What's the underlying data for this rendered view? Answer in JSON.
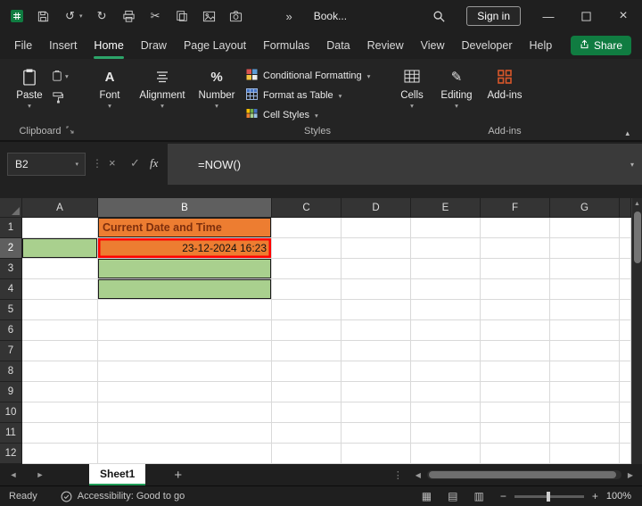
{
  "titlebar": {
    "title": "Book...",
    "sign_in_label": "Sign in"
  },
  "menubar": {
    "items": [
      "File",
      "Insert",
      "Home",
      "Draw",
      "Page Layout",
      "Formulas",
      "Data",
      "Review",
      "View",
      "Developer",
      "Help"
    ],
    "active_item": "Home",
    "share_label": "Share"
  },
  "ribbon": {
    "paste_label": "Paste",
    "font_label": "Font",
    "alignment_label": "Alignment",
    "number_label": "Number",
    "styles": {
      "conditional_formatting": "Conditional Formatting",
      "format_as_table": "Format as Table",
      "cell_styles": "Cell Styles"
    },
    "cells_label": "Cells",
    "editing_label": "Editing",
    "addins_label": "Add-ins",
    "group_labels": {
      "clipboard": "Clipboard",
      "styles": "Styles",
      "addins": "Add-ins"
    }
  },
  "formula_bar": {
    "name_box": "B2",
    "fx_label": "fx",
    "formula": "=NOW()"
  },
  "grid": {
    "columns": [
      "A",
      "B",
      "C",
      "D",
      "E",
      "F",
      "G"
    ],
    "rows": [
      "1",
      "2",
      "3",
      "4",
      "5",
      "6",
      "7",
      "8",
      "9",
      "10",
      "11",
      "12"
    ],
    "selected": {
      "col": "B",
      "row": "2"
    },
    "cells": {
      "B1": {
        "text": "Current Date and Time",
        "fill": "orange",
        "border": "black",
        "bold": true,
        "color": "maroon",
        "align": "left"
      },
      "A2": {
        "fill": "green",
        "border": "black"
      },
      "B2": {
        "text": "23-12-2024 16:23",
        "fill": "orange",
        "border": "red",
        "align": "right"
      },
      "B3": {
        "fill": "green",
        "border": "black"
      },
      "B4": {
        "fill": "green",
        "border": "black"
      }
    }
  },
  "sheet_bar": {
    "tabs": [
      {
        "name": "Sheet1",
        "active": true
      }
    ]
  },
  "status_bar": {
    "mode": "Ready",
    "accessibility": "Accessibility: Good to go",
    "zoom": "100%"
  },
  "colors": {
    "accent_green": "#107C41",
    "tab_underline_green": "#1F9D58",
    "cell_orange": "#ED7D31",
    "cell_green": "#A9D08E",
    "selection_border_red": "#FF0000",
    "header_text_maroon": "#7E2F0D"
  },
  "icons": {
    "undo": "↺",
    "redo": "↻",
    "scissors": "✂",
    "overflow": "»",
    "chevron_down": "▾",
    "chevron_up": "▴",
    "minimize": "—",
    "close": "×",
    "dots_vertical": "⋮",
    "cancel": "×",
    "enter": "✓",
    "plus": "+",
    "minus": "−",
    "nav_left": "◄",
    "nav_right": "►",
    "scroll_left": "◀",
    "scroll_right": "▶",
    "scroll_up": "▲",
    "view_normal": "▦",
    "view_page_layout": "▤",
    "view_page_break": "▥",
    "pencil": "✎",
    "percent": "%",
    "font_letter": "A"
  }
}
